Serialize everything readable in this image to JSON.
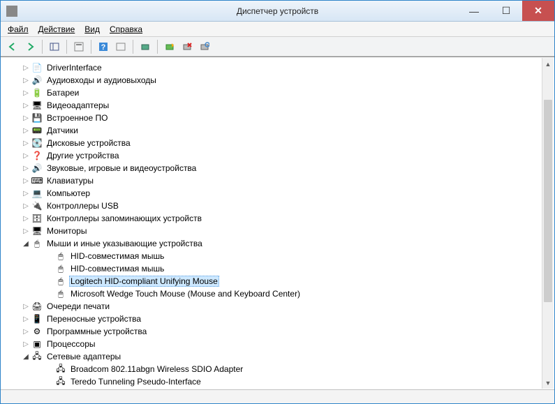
{
  "window": {
    "title": "Диспетчер устройств"
  },
  "menu": {
    "file": "Файл",
    "action": "Действие",
    "view": "Вид",
    "help": "Справка"
  },
  "tree": {
    "items": [
      {
        "label": "DriverInterface",
        "icon": "📄",
        "expanded": false,
        "depth": 1
      },
      {
        "label": "Аудиовходы и аудиовыходы",
        "icon": "🔊",
        "expanded": false,
        "depth": 1
      },
      {
        "label": "Батареи",
        "icon": "🔋",
        "expanded": false,
        "depth": 1
      },
      {
        "label": "Видеоадаптеры",
        "icon": "🖥",
        "expanded": false,
        "depth": 1
      },
      {
        "label": "Встроенное ПО",
        "icon": "💾",
        "expanded": false,
        "depth": 1
      },
      {
        "label": "Датчики",
        "icon": "📟",
        "expanded": false,
        "depth": 1
      },
      {
        "label": "Дисковые устройства",
        "icon": "💽",
        "expanded": false,
        "depth": 1
      },
      {
        "label": "Другие устройства",
        "icon": "❓",
        "expanded": false,
        "depth": 1
      },
      {
        "label": "Звуковые, игровые и видеоустройства",
        "icon": "🔊",
        "expanded": false,
        "depth": 1
      },
      {
        "label": "Клавиатуры",
        "icon": "⌨",
        "expanded": false,
        "depth": 1
      },
      {
        "label": "Компьютер",
        "icon": "💻",
        "expanded": false,
        "depth": 1
      },
      {
        "label": "Контроллеры USB",
        "icon": "🔌",
        "expanded": false,
        "depth": 1
      },
      {
        "label": "Контроллеры запоминающих устройств",
        "icon": "🗄",
        "expanded": false,
        "depth": 1
      },
      {
        "label": "Мониторы",
        "icon": "🖥",
        "expanded": false,
        "depth": 1
      },
      {
        "label": "Мыши и иные указывающие устройства",
        "icon": "🖱",
        "expanded": true,
        "depth": 1
      },
      {
        "label": "HID-совместимая мышь",
        "icon": "🖱",
        "leaf": true,
        "depth": 2
      },
      {
        "label": "HID-совместимая мышь",
        "icon": "🖱",
        "leaf": true,
        "depth": 2
      },
      {
        "label": "Logitech HID-compliant Unifying Mouse",
        "icon": "🖱",
        "leaf": true,
        "depth": 2,
        "selected": true
      },
      {
        "label": "Microsoft Wedge Touch Mouse (Mouse and Keyboard Center)",
        "icon": "🖱",
        "leaf": true,
        "depth": 2
      },
      {
        "label": "Очереди печати",
        "icon": "🖨",
        "expanded": false,
        "depth": 1
      },
      {
        "label": "Переносные устройства",
        "icon": "📱",
        "expanded": false,
        "depth": 1
      },
      {
        "label": "Программные устройства",
        "icon": "⚙",
        "expanded": false,
        "depth": 1
      },
      {
        "label": "Процессоры",
        "icon": "▣",
        "expanded": false,
        "depth": 1
      },
      {
        "label": "Сетевые адаптеры",
        "icon": "🖧",
        "expanded": true,
        "depth": 1
      },
      {
        "label": "Broadcom 802.11abgn Wireless SDIO Adapter",
        "icon": "🖧",
        "leaf": true,
        "depth": 2
      },
      {
        "label": "Teredo Tunneling Pseudo-Interface",
        "icon": "🖧",
        "leaf": true,
        "depth": 2
      }
    ]
  }
}
